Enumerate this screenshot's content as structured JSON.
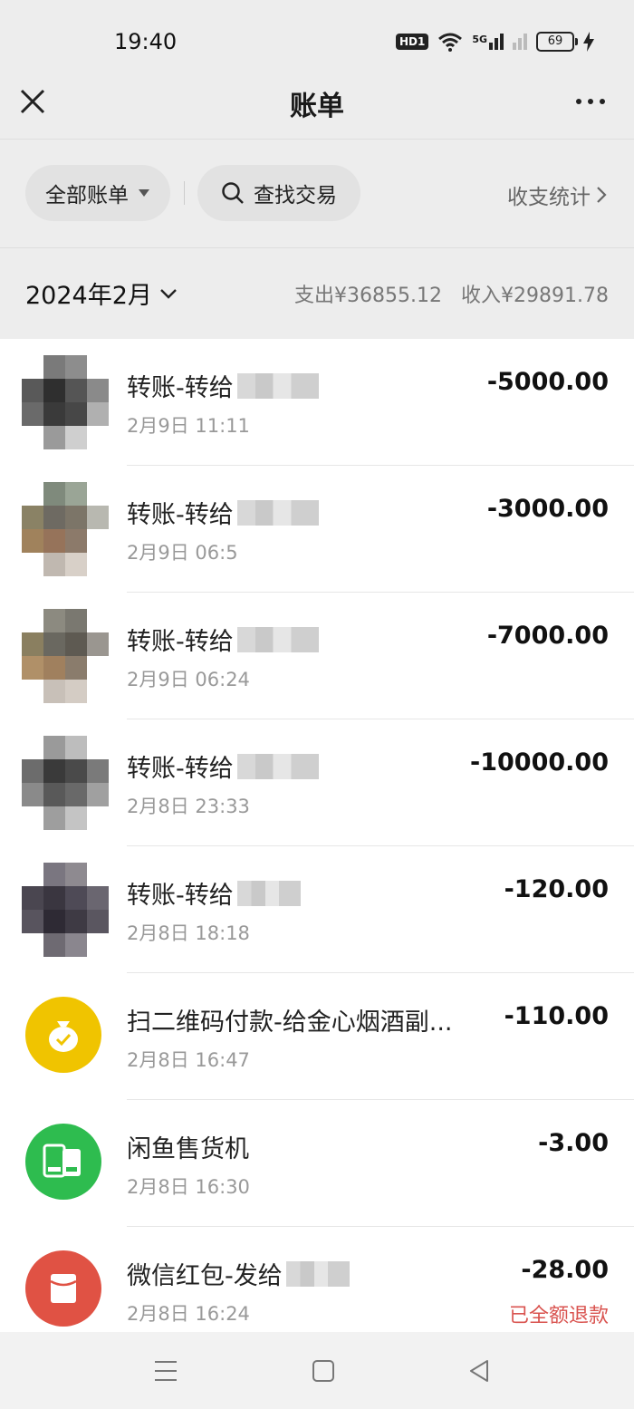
{
  "status_bar": {
    "time": "19:40",
    "hd_label": "HD1",
    "network_label": "5G",
    "battery": "69"
  },
  "header": {
    "title": "账单"
  },
  "filters": {
    "all_bills": "全部账单",
    "search": "查找交易",
    "stats": "收支统计"
  },
  "month_summary": {
    "month": "2024年2月",
    "expense": "支出¥36855.12",
    "income": "收入¥29891.78"
  },
  "transactions": [
    {
      "title": "转账-转给",
      "date": "2月9日 11:11",
      "amount": "-5000.00",
      "icon": "blurred-avatar"
    },
    {
      "title": "转账-转给",
      "date": "2月9日 06:5",
      "amount": "-3000.00",
      "icon": "blurred-avatar"
    },
    {
      "title": "转账-转给",
      "date": "2月9日 06:24",
      "amount": "-7000.00",
      "icon": "blurred-avatar"
    },
    {
      "title": "转账-转给",
      "date": "2月8日 23:33",
      "amount": "-10000.00",
      "icon": "blurred-avatar"
    },
    {
      "title": "转账-转给",
      "date": "2月8日 18:18",
      "amount": "-120.00",
      "icon": "blurred-avatar"
    },
    {
      "title": "扫二维码付款-给金心烟酒副...",
      "date": "2月8日 16:47",
      "amount": "-110.00",
      "icon": "money-bag-icon"
    },
    {
      "title": "闲鱼售货机",
      "date": "2月8日 16:30",
      "amount": "-3.00",
      "icon": "vending-machine-icon"
    },
    {
      "title": "微信红包-发给",
      "date": "2月8日 16:24",
      "amount": "-28.00",
      "icon": "red-packet-icon",
      "note": "已全额退款"
    }
  ],
  "colors": {
    "background": "#ededed",
    "list_bg": "#ffffff",
    "money_bag": "#f0c400",
    "vending": "#2ebc4f",
    "red_packet": "#e05244",
    "refund_text": "#d9534f"
  }
}
